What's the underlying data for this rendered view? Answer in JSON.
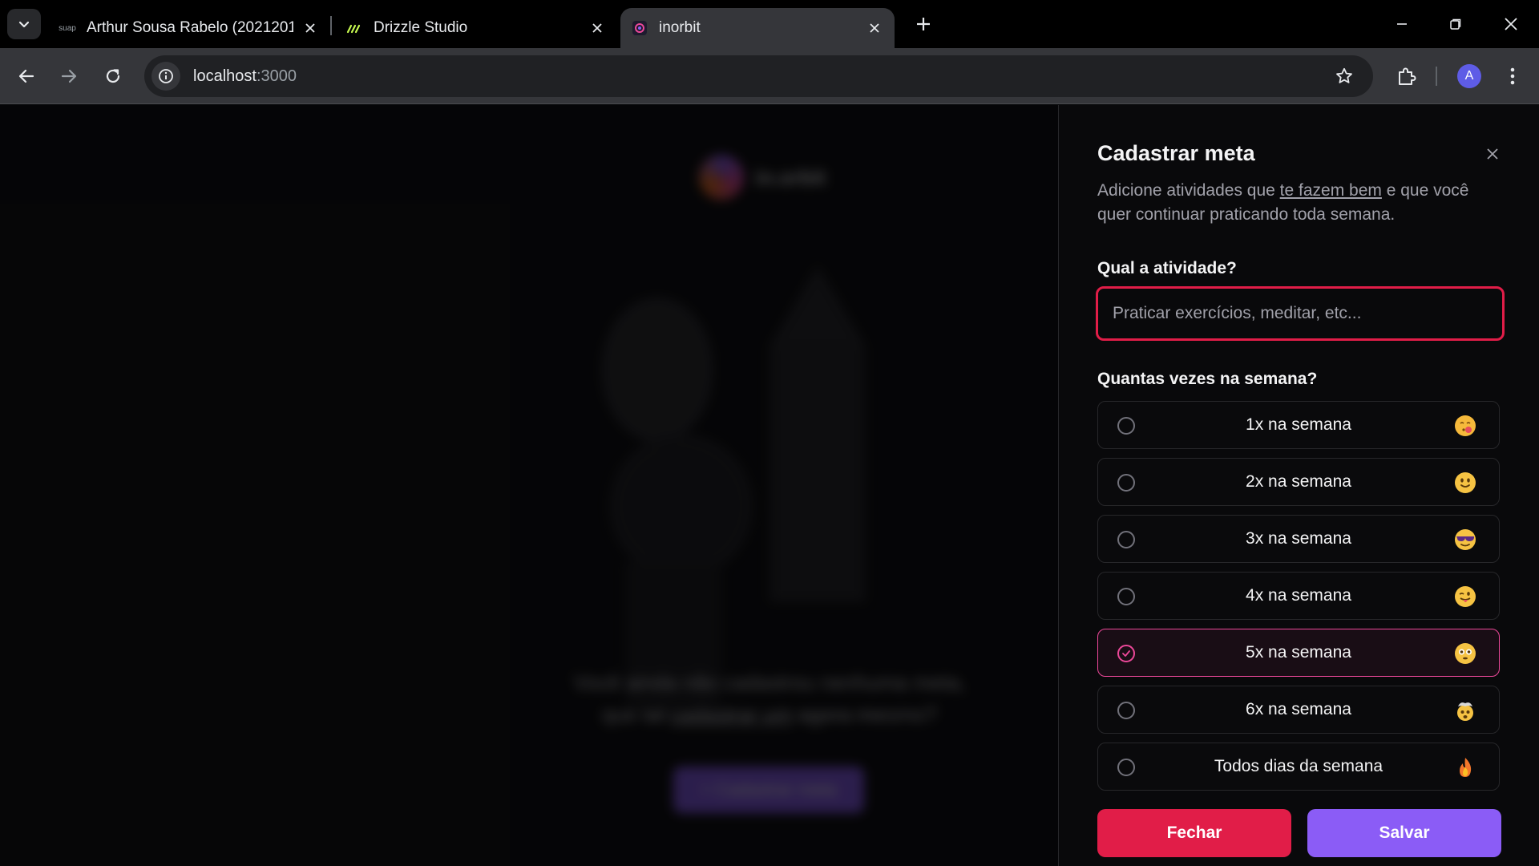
{
  "browser": {
    "tabs": [
      {
        "title": "Arthur Sousa Rabelo (2021201",
        "favicon_text": "suap"
      },
      {
        "title": "Drizzle Studio"
      },
      {
        "title": "inorbit"
      }
    ],
    "url_host": "localhost",
    "url_port": ":3000",
    "profile_initial": "A"
  },
  "background": {
    "logo_text": "in.orbit",
    "empty_line1": "Você ainda não cadastrou nenhuma meta,",
    "empty_line2_prefix": "que tal ",
    "empty_line2_link": "cadastrar um",
    "empty_line2_suffix": " agora mesmo?",
    "cta_label": "+ Cadastrar meta"
  },
  "drawer": {
    "title": "Cadastrar meta",
    "desc_prefix": "Adicione atividades que ",
    "desc_link": "te fazem bem",
    "desc_suffix": " e que você quer continuar praticando toda semana.",
    "activity_label": "Qual a atividade?",
    "activity_placeholder": "Praticar exercícios, meditar, etc...",
    "activity_value": "",
    "frequency_label": "Quantas vezes na semana?",
    "options": [
      {
        "label": "1x na semana",
        "emoji": "kissing-face-icon",
        "selected": false
      },
      {
        "label": "2x na semana",
        "emoji": "slightly-smiling-face-icon",
        "selected": false
      },
      {
        "label": "3x na semana",
        "emoji": "sunglasses-face-icon",
        "selected": false
      },
      {
        "label": "4x na semana",
        "emoji": "winking-tongue-face-icon",
        "selected": false
      },
      {
        "label": "5x na semana",
        "emoji": "flushed-face-icon",
        "selected": true
      },
      {
        "label": "6x na semana",
        "emoji": "exploding-head-icon",
        "selected": false
      },
      {
        "label": "Todos dias da semana",
        "emoji": "fire-icon",
        "selected": false
      }
    ],
    "close_button": "Fechar",
    "save_button": "Salvar"
  },
  "colors": {
    "accent_pink": "#ec4899",
    "danger": "#e11d48",
    "primary": "#8b5cf6",
    "background": "#09090b"
  }
}
